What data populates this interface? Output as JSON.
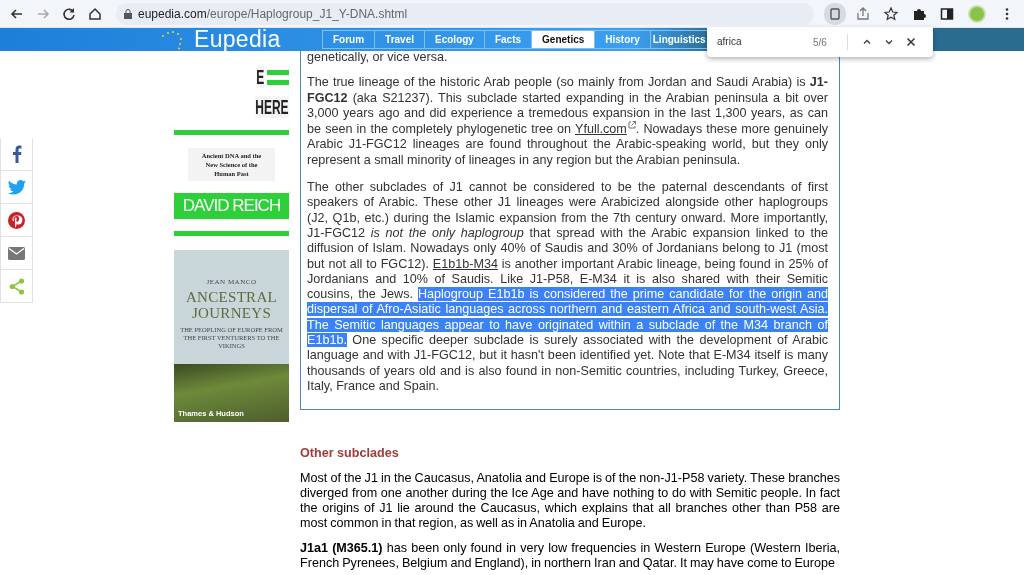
{
  "browser": {
    "url_host": "eupedia.com",
    "url_path": "/europe/Haplogroup_J1_Y-DNA.shtml"
  },
  "site": {
    "logo": "Eupedia",
    "nav": [
      {
        "label": "Forum",
        "selected": false
      },
      {
        "label": "Travel",
        "selected": false
      },
      {
        "label": "Ecology",
        "selected": false
      },
      {
        "label": "Facts",
        "selected": false
      },
      {
        "label": "Genetics",
        "selected": true
      },
      {
        "label": "History",
        "selected": false
      },
      {
        "label": "Linguistics",
        "selected": false
      }
    ]
  },
  "find_bar": {
    "value": "africa",
    "count": "5/6"
  },
  "share_buttons": [
    {
      "kind": "facebook"
    },
    {
      "kind": "twitter"
    },
    {
      "kind": "pinterest"
    },
    {
      "kind": "email"
    },
    {
      "kind": "share"
    }
  ],
  "books": [
    {
      "kind": "stripes",
      "title_fragments": [
        "E",
        "HERE"
      ],
      "subtitle": "Ancient DNA and the New Science of the Human Past",
      "author": "DAVID REICH"
    },
    {
      "kind": "landscape",
      "author": "JEAN MANCO",
      "title": "ANCESTRAL JOURNEYS",
      "subtitle": "THE PEOPLING OF EUROPE FROM THE FIRST VENTURERS TO THE VIKINGS",
      "publisher": "Thames & Hudson"
    }
  ],
  "article": {
    "box_intro": "genetically, or vice versa.",
    "box_paragraphs": [
      [
        {
          "kind": "text",
          "text": "The true lineage of the historic Arab people (so mainly from Jordan and Saudi Arabia) is **J1-FGC12** (aka S21237). This subclade started expanding in the Arabian peninsula a bit over 3,000 years ago and did experience a tremedous expansion in the last 1,300 years, as can be seen in the completely phylogenetic tree on "
        },
        {
          "kind": "external_link",
          "text": "Yfull.com"
        },
        {
          "kind": "text",
          "text": ". Nowadays these more genuinely Arabic J1-FGC12 lineages are found throughout the Arabic-speaking world, but they only represent a small minority of lineages in any region but the Arabian peninsula."
        }
      ],
      [
        {
          "kind": "text",
          "text": "The other subclades of J1 cannot be considered to be the paternal descendants of first speakers of Arabic. These other J1 lineages were Arabicized alongside other haplogroups (J2, Q1b, etc.) during the Islamic expansion from the 7th century onward. More importantly, J1-FGC12 *is not the only haplogroup* that spread with the Arabic expansion linked to the diffusion of Islam. Nowadays only 40% of Saudis and 30% of Jordanians belong to J1 (most but not all to FGC12). "
        },
        {
          "kind": "link",
          "text": "E1b1b-M34"
        },
        {
          "kind": "text",
          "text": " is another important Arabic lineage, being found in 25% of Jordanians and 10% of Saudis. Like J1-P58, E-M34 it is also shared with their Semitic cousins, the Jews. "
        },
        {
          "kind": "selected",
          "text": "Haplogroup E1b1b is considered the prime candidate for the origin and dispersal of Afro-Asiatic languages across northern and eastern Africa and south-west Asia. The Semitic languages appear to have originated within a subclade of the M34 branch of E1b1b."
        },
        {
          "kind": "text",
          "text": " One specific deeper subclade is surely associated with the development of Arabic language and with J1-FGC12, but it hasn't been identified yet. Note that E-M34 itself is many thousands of years old and is also found in non-Semitic countries, including Turkey, Greece, Italy, France and Spain."
        }
      ]
    ],
    "section_heading": "Other subclades",
    "paragraphs": [
      "Most of the J1 in the Caucasus, Anatolia and Europe is of the non-J1-P58 variety. These branches diverged from one another during the Ice Age and have nothing to do with Semitic people. In fact the origins of J1 lie around the Caucasus, which explains that all branches other than P58 are most common in that region, as well as in Anatolia and Europe.",
      "**J1a1 (M365.1)** has been only found in very low frequencies in Western Europe (Western Iberia, French Pyrenees, Belgium and England), in northern Iran and Qatar. It may have come to Europe"
    ]
  }
}
